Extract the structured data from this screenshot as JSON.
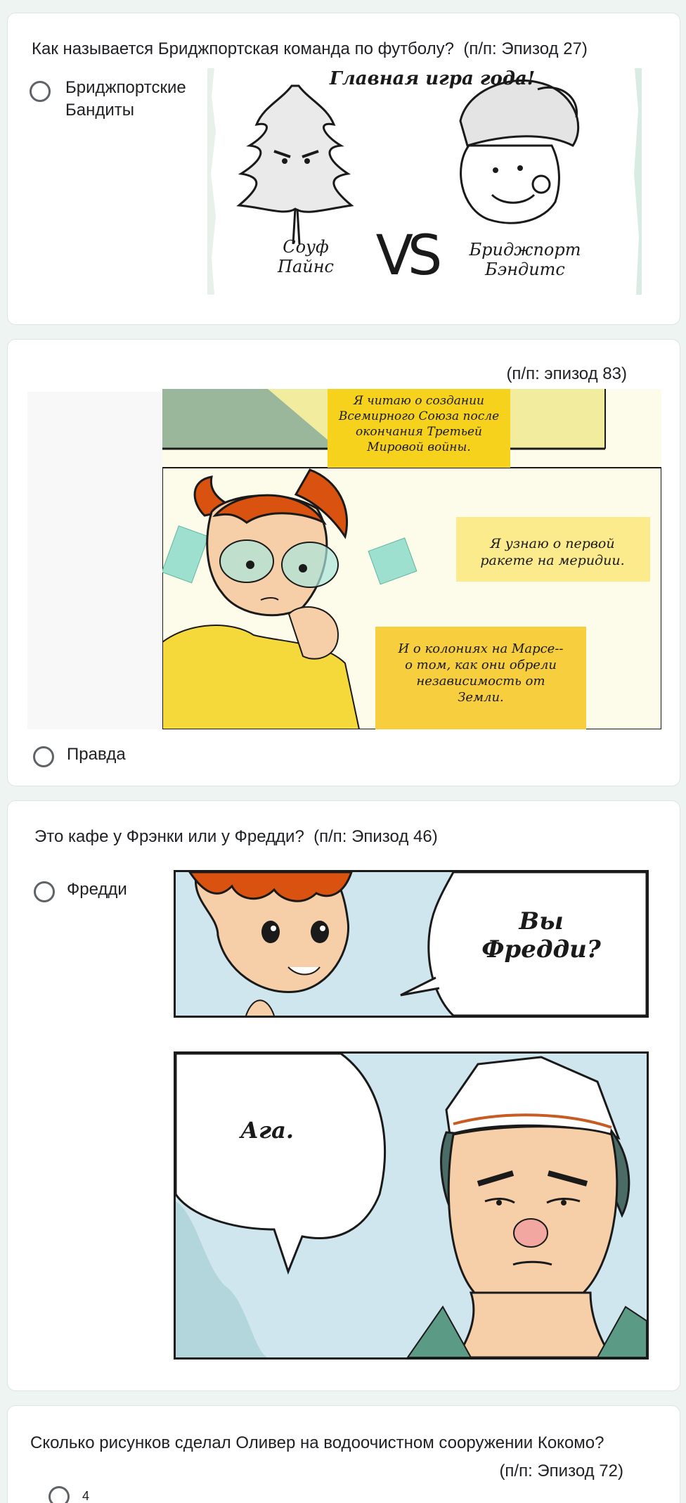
{
  "questions": [
    {
      "text": "Как называется Бриджпортская команда по футболу?",
      "episode": "(п/п: Эпизод 27)",
      "option": "Бриджпортские Бандиты",
      "comic": {
        "headline": "Главная игра года!",
        "team_left": "Соуф Пайнс",
        "versus": "VS",
        "team_right": "Бриджпорт Бэндитс"
      }
    },
    {
      "episode": "(п/п: эпизод 83)",
      "option": "Правда",
      "comic": {
        "box1": "Я читаю о создании Всемирного Союза после окончания Третьей Мировой войны.",
        "box2": "Я узнаю о первой ракете на меридии.",
        "box3": "И о колониях на Марсе-- о том, как они обрели независимость от Земли."
      }
    },
    {
      "text": "Это кафе у Фрэнки или у Фредди?",
      "episode": "(п/п: Эпизод 46)",
      "option": "Фредди",
      "comic": {
        "bubble1": "Вы Фредди?",
        "bubble2": "Ага."
      }
    },
    {
      "text": "Сколько рисунков сделал Оливер на водоочистном сооружении Кокомо?",
      "episode": "(п/п: Эпизод 72)",
      "option": "4"
    }
  ],
  "colors": {
    "page_bg": "#eef4f1",
    "card_bg": "#ffffff",
    "radio_border": "#5f6368",
    "caption_yellow": "#f7d21c",
    "caption_light": "#fbeb8c",
    "hair": "#d9520f"
  }
}
